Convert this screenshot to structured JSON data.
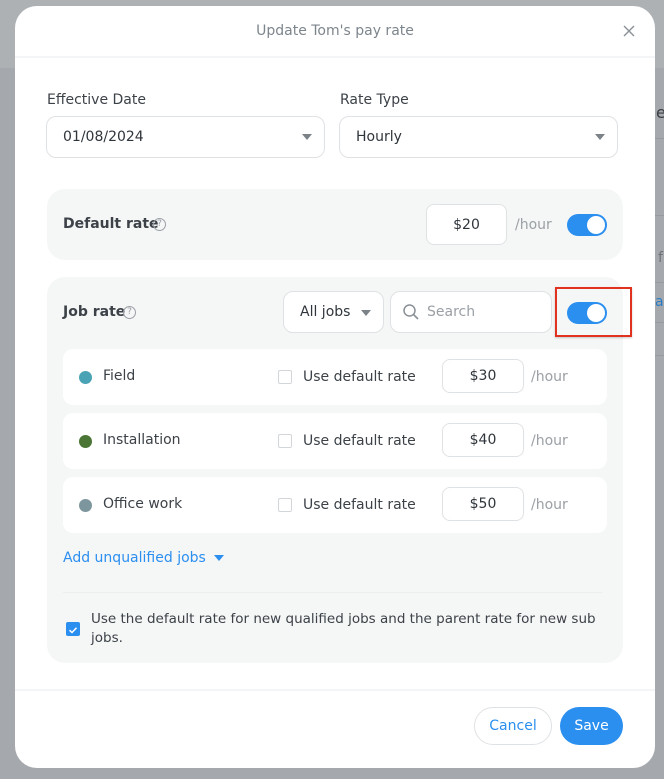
{
  "background": {
    "fragments": [
      "e",
      "f",
      "ay"
    ]
  },
  "modal": {
    "title": "Update Tom's pay rate",
    "close_icon": "close-icon"
  },
  "effective_date": {
    "label": "Effective Date",
    "value": "01/08/2024"
  },
  "rate_type": {
    "label": "Rate Type",
    "value": "Hourly"
  },
  "default_rate": {
    "title": "Default rate",
    "help_icon": "?",
    "value": "$20",
    "unit": "/hour",
    "enabled": true
  },
  "job_rate": {
    "title": "Job rate",
    "help_icon": "?",
    "filter_value": "All jobs",
    "search_placeholder": "Search",
    "enabled": true,
    "use_default_label": "Use default rate",
    "jobs": [
      {
        "name": "Field",
        "color": "#4aa3b5",
        "use_default": false,
        "value": "$30",
        "unit": "/hour"
      },
      {
        "name": "Installation",
        "color": "#4a7534",
        "use_default": false,
        "value": "$40",
        "unit": "/hour"
      },
      {
        "name": "Office work",
        "color": "#7d969e",
        "use_default": false,
        "value": "$50",
        "unit": "/hour"
      }
    ],
    "add_unqualified_label": "Add unqualified jobs",
    "note_checked": true,
    "note": "Use the default rate for new qualified jobs and the parent rate for new sub jobs."
  },
  "footer": {
    "cancel_label": "Cancel",
    "save_label": "Save"
  },
  "colors": {
    "accent": "#2b8ff0",
    "highlight": "#e0321f"
  }
}
